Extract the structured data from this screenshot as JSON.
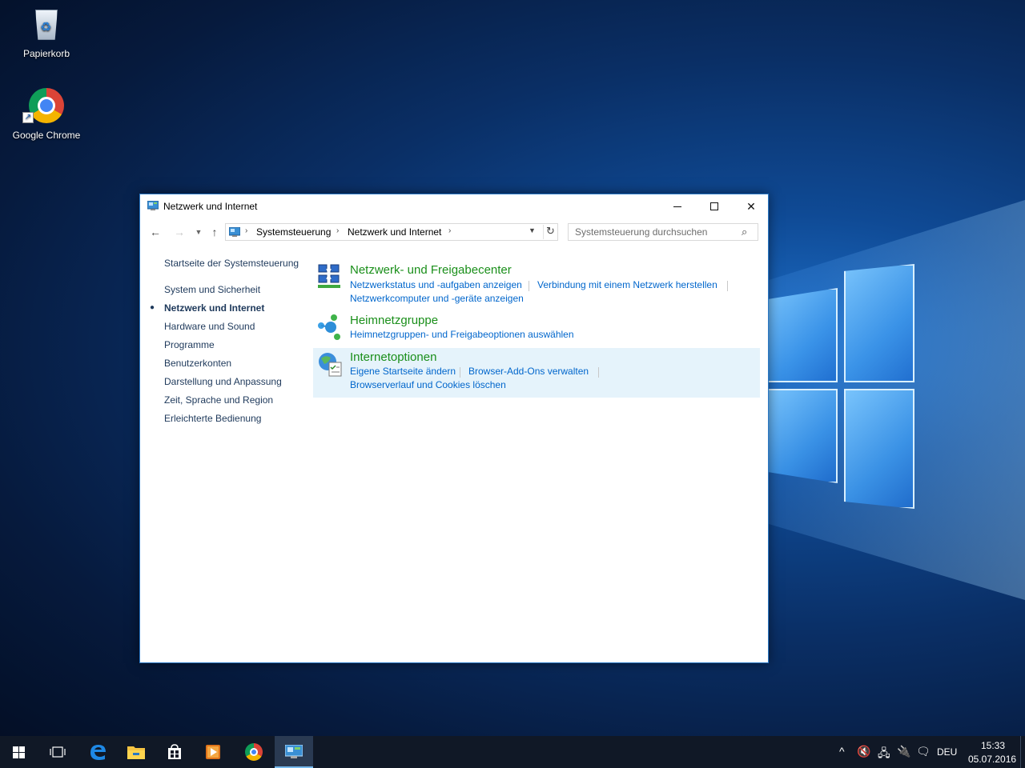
{
  "desktop": {
    "icons": [
      {
        "label": "Papierkorb"
      },
      {
        "label": "Google Chrome"
      }
    ]
  },
  "window": {
    "title": "Netzwerk und Internet",
    "breadcrumb": [
      "Systemsteuerung",
      "Netzwerk und Internet"
    ],
    "search": {
      "placeholder": "Systemsteuerung durchsuchen"
    },
    "sidebar": {
      "items": [
        {
          "label": "Startseite der Systemsteuerung",
          "active": false
        },
        {
          "label": "System und Sicherheit",
          "active": false
        },
        {
          "label": "Netzwerk und Internet",
          "active": true
        },
        {
          "label": "Hardware und Sound",
          "active": false
        },
        {
          "label": "Programme",
          "active": false
        },
        {
          "label": "Benutzerkonten",
          "active": false
        },
        {
          "label": "Darstellung und Anpassung",
          "active": false
        },
        {
          "label": "Zeit, Sprache und Region",
          "active": false
        },
        {
          "label": "Erleichterte Bedienung",
          "active": false
        }
      ],
      "bullet": "●"
    },
    "categories": [
      {
        "title": "Netzwerk- und Freigabecenter",
        "tasks": [
          "Netzwerkstatus und -aufgaben anzeigen",
          "Verbindung mit einem Netzwerk herstellen",
          "Netzwerkcomputer und -geräte anzeigen"
        ]
      },
      {
        "title": "Heimnetzgruppe",
        "tasks": [
          "Heimnetzgruppen- und Freigabeoptionen auswählen"
        ]
      },
      {
        "title": "Internetoptionen",
        "tasks": [
          "Eigene Startseite ändern",
          "Browser-Add-Ons verwalten",
          "Browserverlauf und Cookies löschen"
        ]
      }
    ],
    "colors": {
      "category_title": "#1a8f1a",
      "task_link": "#0066cc",
      "highlight": "#e5f3fb",
      "accent": "#76b9ed"
    }
  },
  "taskbar": {
    "apps": [
      "start-icon",
      "task-view-icon",
      "edge-icon",
      "file-explorer-icon",
      "store-icon",
      "media-player-icon",
      "chrome-icon",
      "control-panel-icon"
    ],
    "tray": {
      "language": "DEU",
      "time": "15:33",
      "date": "05.07.2016"
    }
  }
}
